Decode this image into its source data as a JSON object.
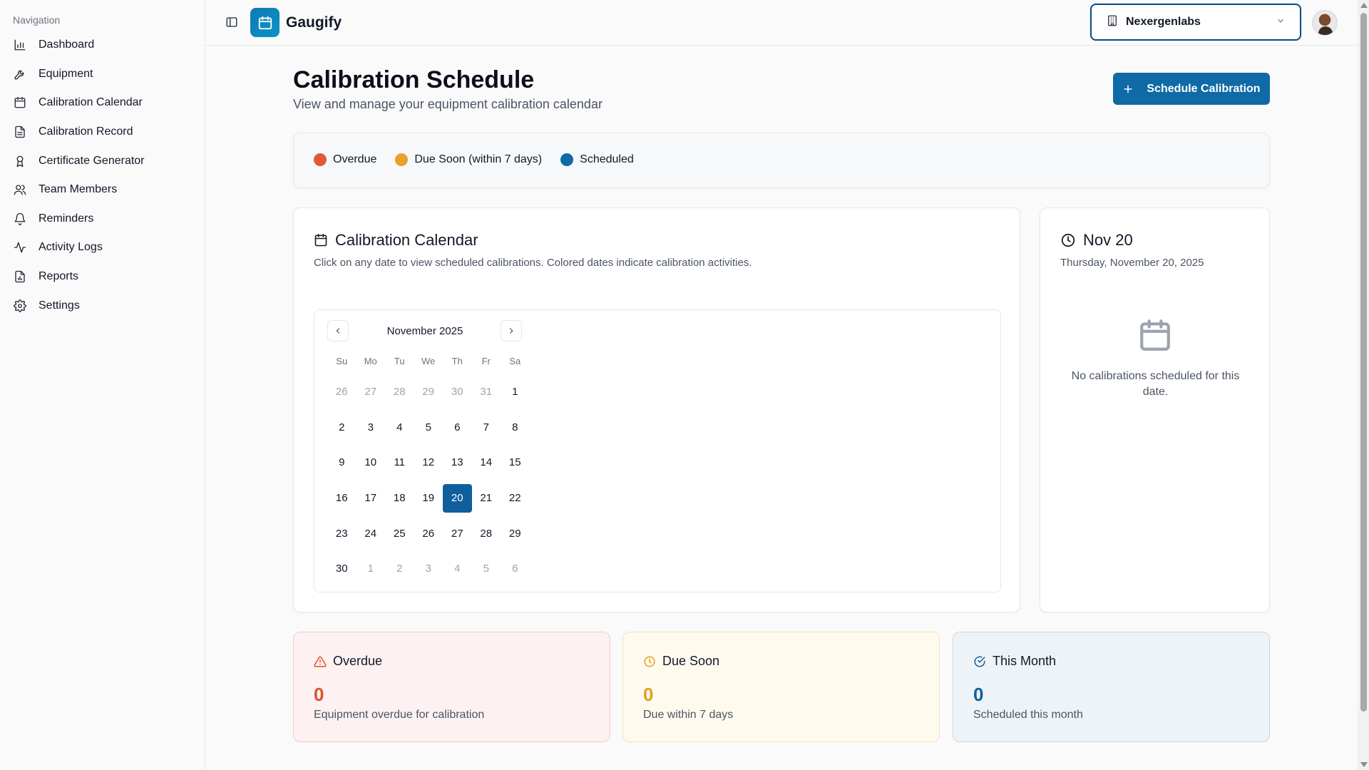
{
  "sidebar": {
    "heading": "Navigation",
    "items": [
      {
        "label": "Dashboard",
        "icon": "bar-chart-icon"
      },
      {
        "label": "Equipment",
        "icon": "wrench-icon"
      },
      {
        "label": "Calibration Calendar",
        "icon": "calendar-icon"
      },
      {
        "label": "Calibration Record",
        "icon": "document-icon"
      },
      {
        "label": "Certificate Generator",
        "icon": "award-icon"
      },
      {
        "label": "Team Members",
        "icon": "users-icon"
      },
      {
        "label": "Reminders",
        "icon": "bell-icon"
      },
      {
        "label": "Activity Logs",
        "icon": "activity-icon"
      },
      {
        "label": "Reports",
        "icon": "report-icon"
      },
      {
        "label": "Settings",
        "icon": "gear-icon"
      }
    ]
  },
  "topbar": {
    "brand": "Gaugify",
    "org": "Nexergenlabs"
  },
  "header": {
    "title": "Calibration Schedule",
    "subtitle": "View and manage your equipment calibration calendar",
    "primary_button": "Schedule Calibration"
  },
  "legend": [
    {
      "label": "Overdue",
      "color": "#e05a3a"
    },
    {
      "label": "Due Soon (within 7 days)",
      "color": "#e8a12c"
    },
    {
      "label": "Scheduled",
      "color": "#0f6aa6"
    }
  ],
  "calendar_card": {
    "title": "Calibration Calendar",
    "description": "Click on any date to view scheduled calibrations. Colored dates indicate calibration activities.",
    "month_label": "November 2025",
    "weekdays": [
      "Su",
      "Mo",
      "Tu",
      "We",
      "Th",
      "Fr",
      "Sa"
    ],
    "weeks": [
      [
        {
          "d": "26",
          "out": true
        },
        {
          "d": "27",
          "out": true
        },
        {
          "d": "28",
          "out": true
        },
        {
          "d": "29",
          "out": true
        },
        {
          "d": "30",
          "out": true
        },
        {
          "d": "31",
          "out": true
        },
        {
          "d": "1"
        }
      ],
      [
        {
          "d": "2"
        },
        {
          "d": "3"
        },
        {
          "d": "4"
        },
        {
          "d": "5"
        },
        {
          "d": "6"
        },
        {
          "d": "7"
        },
        {
          "d": "8"
        }
      ],
      [
        {
          "d": "9"
        },
        {
          "d": "10"
        },
        {
          "d": "11"
        },
        {
          "d": "12"
        },
        {
          "d": "13"
        },
        {
          "d": "14"
        },
        {
          "d": "15"
        }
      ],
      [
        {
          "d": "16"
        },
        {
          "d": "17"
        },
        {
          "d": "18"
        },
        {
          "d": "19"
        },
        {
          "d": "20",
          "selected": true
        },
        {
          "d": "21"
        },
        {
          "d": "22"
        }
      ],
      [
        {
          "d": "23"
        },
        {
          "d": "24"
        },
        {
          "d": "25"
        },
        {
          "d": "26"
        },
        {
          "d": "27"
        },
        {
          "d": "28"
        },
        {
          "d": "29"
        }
      ],
      [
        {
          "d": "30"
        },
        {
          "d": "1",
          "out": true
        },
        {
          "d": "2",
          "out": true
        },
        {
          "d": "3",
          "out": true
        },
        {
          "d": "4",
          "out": true
        },
        {
          "d": "5",
          "out": true
        },
        {
          "d": "6",
          "out": true
        }
      ]
    ]
  },
  "date_panel": {
    "title": "Nov 20",
    "full_date": "Thursday, November 20, 2025",
    "empty_message": "No calibrations scheduled for this date."
  },
  "stats": {
    "overdue": {
      "title": "Overdue",
      "value": "0",
      "label": "Equipment overdue for calibration",
      "color": "#d9532f"
    },
    "due_soon": {
      "title": "Due Soon",
      "value": "0",
      "label": "Due within 7 days",
      "color": "#e0a020"
    },
    "this_month": {
      "title": "This Month",
      "value": "0",
      "label": "Scheduled this month",
      "color": "#0f5f9c"
    }
  }
}
